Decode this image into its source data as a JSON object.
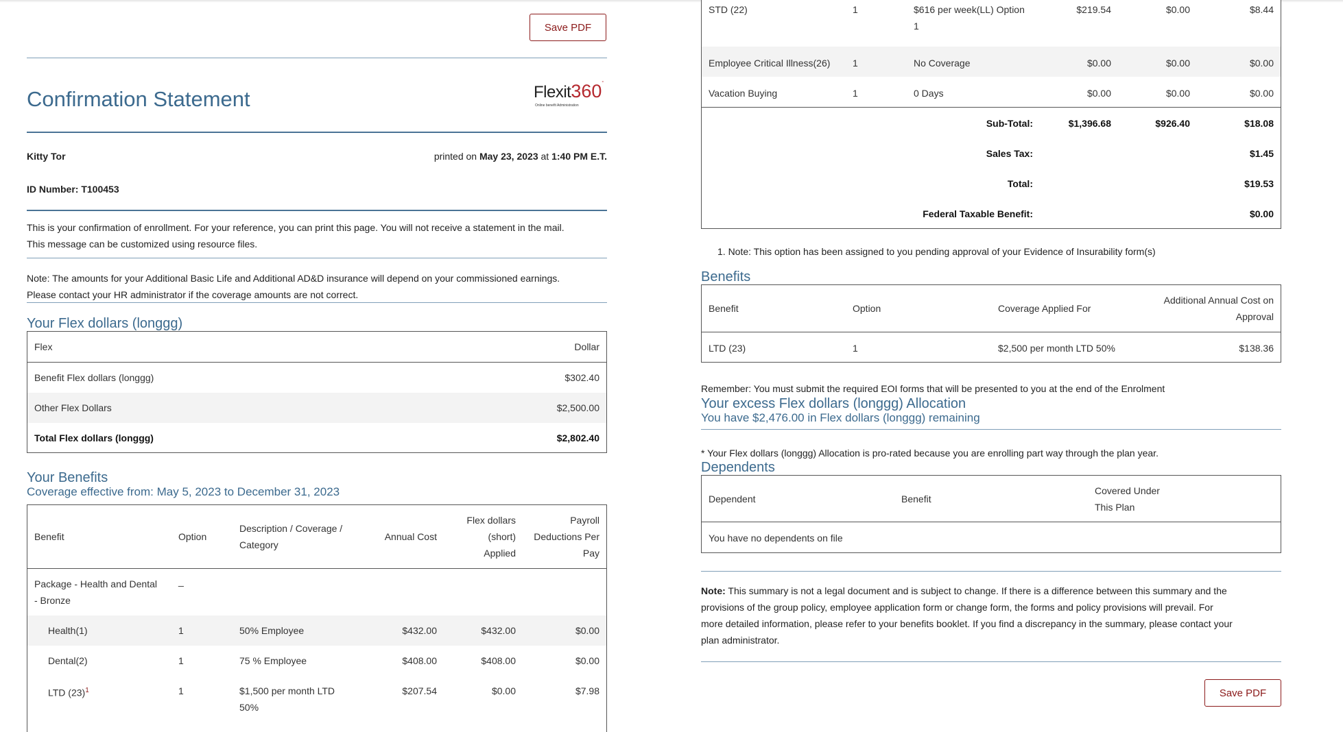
{
  "left": {
    "save_pdf": "Save PDF",
    "title": "Confirmation Statement",
    "logo": {
      "name": "Flexit",
      "num": "360",
      "tagline": "Online benefit Administration"
    },
    "person_name": "Kitty Tor",
    "printed_prefix": "printed on",
    "printed_date": "May 23, 2023",
    "printed_at": "at",
    "printed_time": "1:40 PM E.T.",
    "id_number": "ID Number: T100453",
    "message_line1": "This is your confirmation of enrollment. For your reference, you can print this page. You will not receive a statement in the mail.",
    "message_line2": "This message can be customized using resource files.",
    "note_line1": "Note: The amounts for your Additional Basic Life and Additional AD&D insurance will depend on your commissioned earnings.",
    "note_line2": "Please contact your HR administrator if the coverage amounts are not correct.",
    "flex_heading": "Your Flex dollars (longgg)",
    "flex_table": {
      "col_flex": "Flex",
      "col_dollar": "Dollar",
      "rows": [
        {
          "name": "Benefit Flex dollars (longgg)",
          "value": "$302.40"
        },
        {
          "name": "Other Flex Dollars",
          "value": "$2,500.00"
        }
      ],
      "total_name": "Total Flex dollars (longgg)",
      "total_value": "$2,802.40"
    },
    "benefits_heading": "Your Benefits",
    "coverage_effective": "Coverage effective from: May 5, 2023 to December 31, 2023",
    "benefits_table": {
      "h_benefit": "Benefit",
      "h_option": "Option",
      "h_desc_1": "Description / Coverage /",
      "h_desc_2": "Category",
      "h_annual": "Annual Cost",
      "h_flex_1": "Flex dollars",
      "h_flex_2": "(short)",
      "h_flex_3": "Applied",
      "h_payroll_1": "Payroll",
      "h_payroll_2": "Deductions Per",
      "h_payroll_3": "Pay",
      "package_1": "Package - Health and Dental",
      "package_2": "- Bronze",
      "package_option": "_",
      "rows": [
        {
          "benefit": "Health(1)",
          "option": "1",
          "desc": "50% Employee",
          "annual": "$432.00",
          "flex": "$432.00",
          "payroll": "$0.00"
        },
        {
          "benefit": "Dental(2)",
          "option": "1",
          "desc": "75 % Employee",
          "annual": "$408.00",
          "flex": "$408.00",
          "payroll": "$0.00"
        },
        {
          "benefit": "LTD (23)",
          "sup": "1",
          "option": "1",
          "desc": "$1,500 per month LTD",
          "desc_2": "50%",
          "annual": "$207.54",
          "flex": "$0.00",
          "payroll": "$7.98"
        }
      ]
    }
  },
  "right": {
    "top_rows": [
      {
        "benefit": "STD (22)",
        "option": "1",
        "desc": "$616 per week(LL) Option",
        "desc_2": "1",
        "annual": "$219.54",
        "flex": "$0.00",
        "payroll": "$8.44"
      },
      {
        "benefit": "Employee Critical Illness(26)",
        "option": "1",
        "desc": "No Coverage",
        "annual": "$0.00",
        "flex": "$0.00",
        "payroll": "$0.00"
      },
      {
        "benefit": "Vacation Buying",
        "option": "1",
        "desc": "0 Days",
        "annual": "$0.00",
        "flex": "$0.00",
        "payroll": "$0.00"
      }
    ],
    "subtotal_label": "Sub-Total:",
    "subtotal_annual": "$1,396.68",
    "subtotal_flex": "$926.40",
    "subtotal_payroll": "$18.08",
    "sales_tax_label": "Sales Tax:",
    "sales_tax_value": "$1.45",
    "total_label": "Total:",
    "total_value": "$19.53",
    "federal_label": "Federal Taxable Benefit:",
    "federal_value": "$0.00",
    "footnote": "1. Note: This option has been assigned to you pending approval of your Evidence of Insurability form(s)",
    "benefits_heading": "Benefits",
    "eoi_table": {
      "h_benefit": "Benefit",
      "h_option": "Option",
      "h_coverage": "Coverage Applied For",
      "h_additional_1": "Additional Annual Cost on",
      "h_additional_2": "Approval",
      "row": {
        "benefit": "LTD (23)",
        "option": "1",
        "coverage": "$2,500 per month LTD 50%",
        "additional": "$138.36"
      }
    },
    "remember": "Remember: You must submit the required EOI forms that will be presented to you at the end of the Enrolment",
    "excess_heading": "Your excess Flex dollars (longgg) Allocation",
    "excess_sub": "You have $2,476.00 in Flex dollars (longgg) remaining",
    "prorated_note": "* Your Flex dollars (longgg) Allocation is pro-rated because you are enrolling part way through the plan year.",
    "dependents_heading": "Dependents",
    "dep_table": {
      "h_dependent": "Dependent",
      "h_benefit": "Benefit",
      "h_covered_1": "Covered Under",
      "h_covered_2": "This Plan",
      "empty": "You have no dependents on file"
    },
    "summary_note_label": "Note:",
    "summary_note_1": " This summary is not a legal document and is subject to change. If there is a difference between this summary and the",
    "summary_note_2": "provisions of the group policy, employee application form or change form, the forms and policy provisions will prevail. For",
    "summary_note_3": "more detailed information, please refer to your benefits booklet. If you find a discrepancy in the summary, please contact your",
    "summary_note_4": "plan administrator.",
    "save_pdf": "Save PDF"
  }
}
